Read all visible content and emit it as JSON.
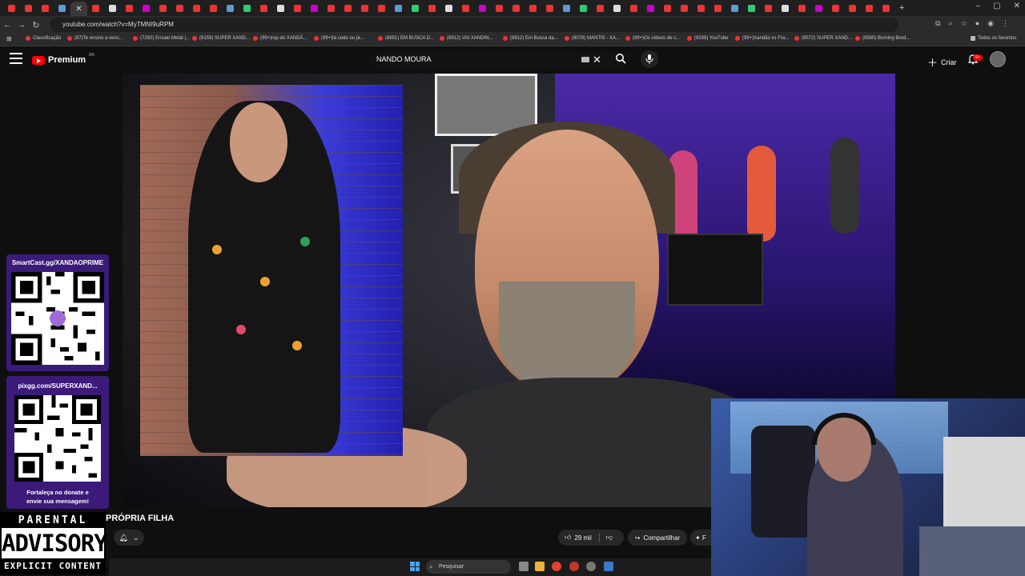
{
  "browser": {
    "url": "youtube.com/watch?v=MyTMNI9uRPM",
    "tabs_count": 53,
    "window_controls": [
      "–",
      "▢",
      "✕"
    ],
    "bookmarks": [
      "Classificação",
      "(97)Te ensino a venc...",
      "(7292) Ensaio Metal |...",
      "(8159) SUPER XAND...",
      "(99+)rap do XANDÃ...",
      "(99+)tá cedo ou já...",
      "(8851) EM BUSCA D...",
      "(8912) VAI XANDIN...",
      "(8912) Em Busca da...",
      "(9078) MANTIS - XA...",
      "(99+)Os vídeos de c...",
      "(9338) YouTube",
      "(99+)Xandão vs Fra...",
      "(9572) SUPER XAND...",
      "(9580) Burning Bord...",
      "Todos os favoritos"
    ]
  },
  "youtube": {
    "logo_text": "Premium",
    "logo_region": "BR",
    "search_value": "NANDO MOURA",
    "create_label": "Criar",
    "notifications_badge": "9+"
  },
  "stream_overlay": {
    "qr1_title": "SmartCast.gg/XANDAOPRIME",
    "qr2_title": "pixgg.com/SUPERXAND...",
    "donate_text_line1": "Fortaleça no donate e",
    "donate_text_line2": "envie sua mensagem!",
    "advisory_top": "PARENTAL",
    "advisory_mid": "ADVISORY",
    "advisory_bottom": "EXPLICIT CONTENT"
  },
  "video": {
    "title_fragment": "PRÓPRIA FILHA",
    "likes": "29 mil",
    "share_label": "Compartilhar",
    "more_label": "F"
  },
  "taskbar": {
    "search_placeholder": "Pesquisar"
  },
  "colors": {
    "yt_red": "#ff0000",
    "overlay_purple": "#3b1a7a",
    "bg": "#0f0f0f"
  }
}
